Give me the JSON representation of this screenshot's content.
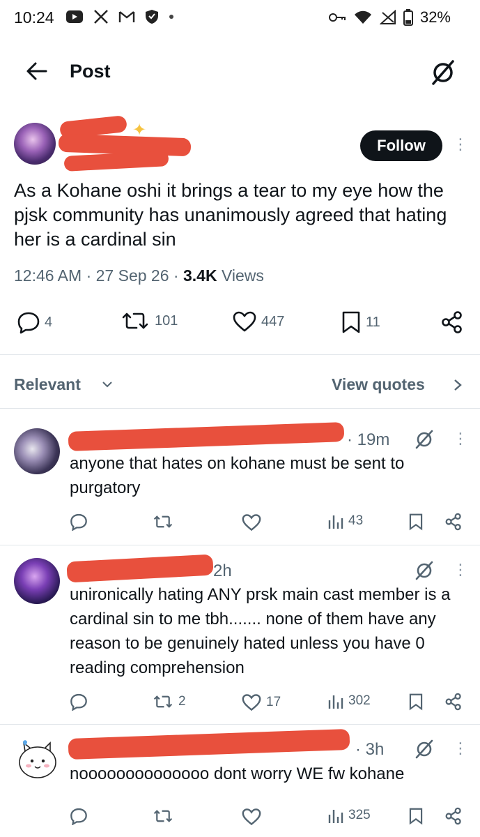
{
  "status_bar": {
    "time": "10:24",
    "battery": "32%",
    "left_icons": [
      "youtube-icon",
      "x-logo-icon",
      "gmail-icon",
      "shield-icon",
      "dot-icon"
    ],
    "right_icons": [
      "key-icon",
      "wifi-icon",
      "signal-icon",
      "battery-icon"
    ]
  },
  "header": {
    "title": "Post"
  },
  "post": {
    "follow_label": "Follow",
    "text": "As a Kohane oshi it brings a tear to my eye how the pjsk community has unanimously agreed that hating her is a cardinal sin",
    "time": "12:46 AM",
    "date": "27 Sep 26",
    "views_count": "3.4K",
    "views_label": "Views",
    "sep": "·",
    "replies": "4",
    "reposts": "101",
    "likes": "447",
    "bookmarks": "11"
  },
  "sort": {
    "label": "Relevant",
    "quotes_label": "View quotes"
  },
  "replies": [
    {
      "time": "· 19m",
      "text": "anyone that hates on kohane must be sent to purgatory",
      "reposts": "",
      "likes": "",
      "views": "43"
    },
    {
      "time": "2h",
      "text": "unironically hating ANY prsk main cast member is a cardinal sin to me tbh....... none of them have any reason to be genuinely hated unless you have 0 reading comprehension",
      "reposts": "2",
      "likes": "17",
      "views": "302"
    },
    {
      "time": "· 3h",
      "text": "noooooooooooooo dont worry WE fw kohane",
      "reposts": "",
      "likes": "",
      "views": "325"
    }
  ],
  "colors": {
    "text": "#0f1419",
    "secondary": "#536471",
    "redaction": "#e8503d",
    "follow_bg": "#0f1419"
  }
}
